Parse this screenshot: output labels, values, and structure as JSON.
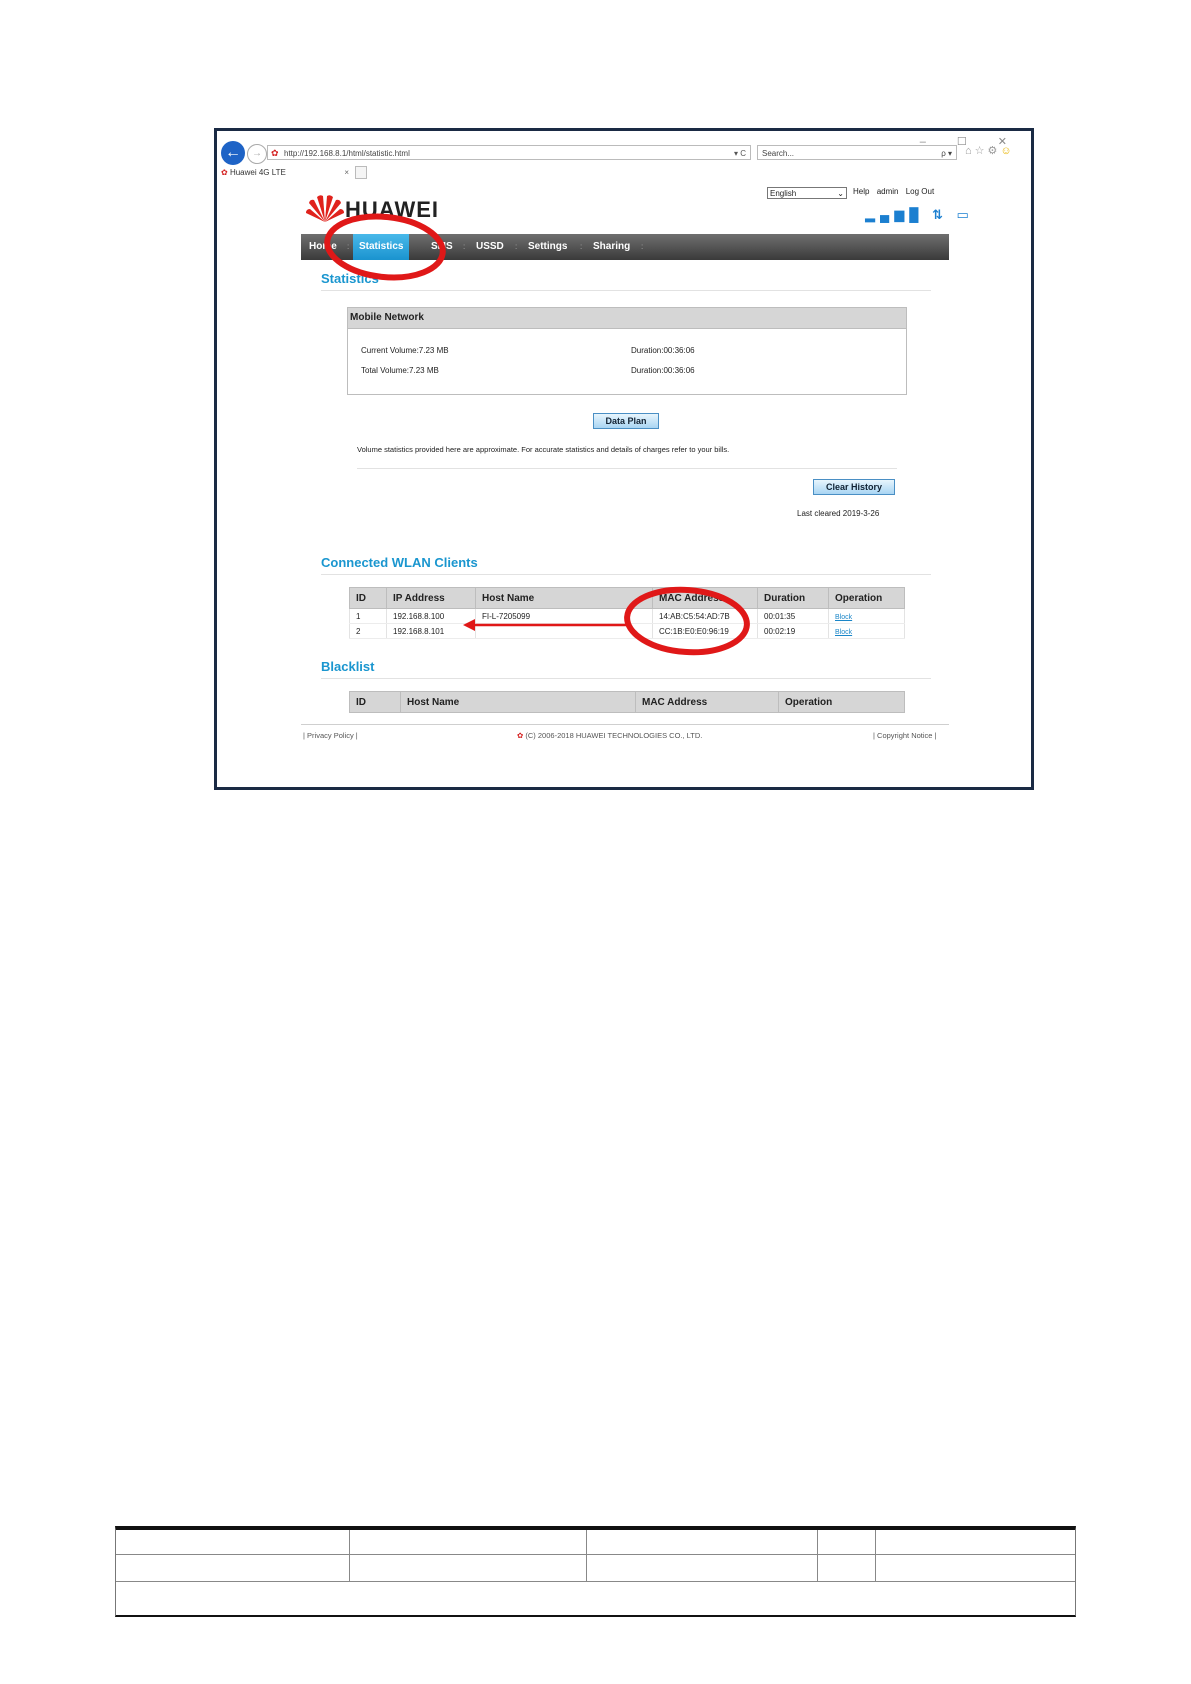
{
  "browser": {
    "window_controls": "– ☐ ✕",
    "address": "http://192.168.8.1/html/statistic.html",
    "address_tail": "▾ C",
    "search_placeholder": "Search...",
    "search_tail": "ρ ▾",
    "tab_title": "Huawei 4G LTE",
    "tab_close": "×"
  },
  "header": {
    "language": "English",
    "help": "Help",
    "user": "admin",
    "logout": "Log Out",
    "logo_text": "HUAWEI",
    "status_icons": "▂▄▆█ ⇅ ▭"
  },
  "menu": {
    "items": [
      {
        "label": "Home"
      },
      {
        "label": "Statistics"
      },
      {
        "label": "SMS"
      },
      {
        "label": "USSD"
      },
      {
        "label": "Settings"
      },
      {
        "label": "Sharing"
      }
    ],
    "separator": ":"
  },
  "statistics": {
    "title": "Statistics",
    "panel_title": "Mobile Network",
    "current_volume": "Current Volume:7.23 MB",
    "current_duration": "Duration:00:36:06",
    "total_volume": "Total Volume:7.23 MB",
    "total_duration": "Duration:00:36:06",
    "data_plan_button": "Data Plan",
    "note": "Volume statistics provided here are approximate. For accurate statistics and details of charges refer to your bills.",
    "clear_history_button": "Clear History",
    "last_cleared": "Last cleared 2019-3-26"
  },
  "wlan": {
    "title": "Connected WLAN Clients",
    "columns": [
      "ID",
      "IP Address",
      "Host Name",
      "MAC Address",
      "Duration",
      "Operation"
    ],
    "rows": [
      {
        "id": "1",
        "ip": "192.168.8.100",
        "host": "FI-L-7205099",
        "mac": "14:AB:C5:54:AD:7B",
        "duration": "00:01:35",
        "op": "Block"
      },
      {
        "id": "2",
        "ip": "192.168.8.101",
        "host": "",
        "mac": "CC:1B:E0:E0:96:19",
        "duration": "00:02:19",
        "op": "Block"
      }
    ]
  },
  "blacklist": {
    "title": "Blacklist",
    "columns": [
      "ID",
      "Host Name",
      "MAC Address",
      "Operation"
    ]
  },
  "footer": {
    "privacy": "| Privacy Policy |",
    "copyright": "(C) 2006-2018 HUAWEI TECHNOLOGIES CO., LTD.",
    "notice": "| Copyright Notice |"
  },
  "colors": {
    "accent": "#1a96cf",
    "annotation": "#e01818",
    "menubar": "#4a4a4a"
  }
}
